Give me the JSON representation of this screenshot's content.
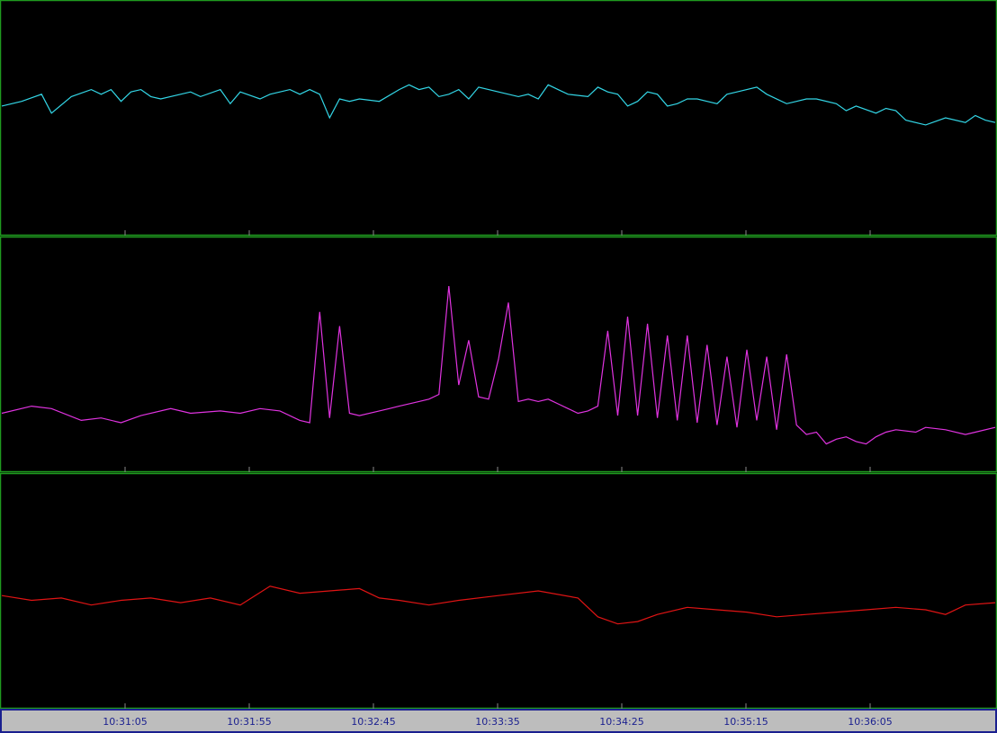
{
  "chart_data": {
    "type": "line",
    "x_unit": "time",
    "x_ticks": [
      "10:31:05",
      "10:31:55",
      "10:32:45",
      "10:33:35",
      "10:34:25",
      "10:35:15",
      "10:36:05"
    ],
    "x_range_seconds_per_tick": 50,
    "grid": false,
    "channels": [
      {
        "color": "#33d6e6",
        "ylim": [
          0,
          100
        ],
        "points": [
          [
            0,
            55
          ],
          [
            2,
            57
          ],
          [
            4,
            60
          ],
          [
            5,
            52
          ],
          [
            7,
            59
          ],
          [
            9,
            62
          ],
          [
            10,
            60
          ],
          [
            11,
            62
          ],
          [
            12,
            57
          ],
          [
            13,
            61
          ],
          [
            14,
            62
          ],
          [
            15,
            59
          ],
          [
            16,
            58
          ],
          [
            18,
            60
          ],
          [
            19,
            61
          ],
          [
            20,
            59
          ],
          [
            22,
            62
          ],
          [
            23,
            56
          ],
          [
            24,
            61
          ],
          [
            26,
            58
          ],
          [
            27,
            60
          ],
          [
            29,
            62
          ],
          [
            30,
            60
          ],
          [
            31,
            62
          ],
          [
            32,
            60
          ],
          [
            33,
            50
          ],
          [
            34,
            58
          ],
          [
            35,
            57
          ],
          [
            36,
            58
          ],
          [
            38,
            57
          ],
          [
            40,
            62
          ],
          [
            41,
            64
          ],
          [
            42,
            62
          ],
          [
            43,
            63
          ],
          [
            44,
            59
          ],
          [
            45,
            60
          ],
          [
            46,
            62
          ],
          [
            47,
            58
          ],
          [
            48,
            63
          ],
          [
            50,
            61
          ],
          [
            52,
            59
          ],
          [
            53,
            60
          ],
          [
            54,
            58
          ],
          [
            55,
            64
          ],
          [
            56,
            62
          ],
          [
            57,
            60
          ],
          [
            59,
            59
          ],
          [
            60,
            63
          ],
          [
            61,
            61
          ],
          [
            62,
            60
          ],
          [
            63,
            55
          ],
          [
            64,
            57
          ],
          [
            65,
            61
          ],
          [
            66,
            60
          ],
          [
            67,
            55
          ],
          [
            68,
            56
          ],
          [
            69,
            58
          ],
          [
            70,
            58
          ],
          [
            71,
            57
          ],
          [
            72,
            56
          ],
          [
            73,
            60
          ],
          [
            74,
            61
          ],
          [
            76,
            63
          ],
          [
            77,
            60
          ],
          [
            79,
            56
          ],
          [
            80,
            57
          ],
          [
            81,
            58
          ],
          [
            82,
            58
          ],
          [
            84,
            56
          ],
          [
            85,
            53
          ],
          [
            86,
            55
          ],
          [
            88,
            52
          ],
          [
            89,
            54
          ],
          [
            90,
            53
          ],
          [
            91,
            49
          ],
          [
            93,
            47
          ],
          [
            95,
            50
          ],
          [
            97,
            48
          ],
          [
            98,
            51
          ],
          [
            99,
            49
          ],
          [
            100,
            48
          ]
        ]
      },
      {
        "color": "#e033e0",
        "ylim": [
          0,
          100
        ],
        "points": [
          [
            0,
            25
          ],
          [
            3,
            28
          ],
          [
            5,
            27
          ],
          [
            8,
            22
          ],
          [
            10,
            23
          ],
          [
            12,
            21
          ],
          [
            14,
            24
          ],
          [
            17,
            27
          ],
          [
            19,
            25
          ],
          [
            22,
            26
          ],
          [
            24,
            25
          ],
          [
            26,
            27
          ],
          [
            28,
            26
          ],
          [
            30,
            22
          ],
          [
            31,
            21
          ],
          [
            32,
            68
          ],
          [
            33,
            23
          ],
          [
            34,
            62
          ],
          [
            35,
            25
          ],
          [
            36,
            24
          ],
          [
            38,
            26
          ],
          [
            39,
            27
          ],
          [
            40,
            28
          ],
          [
            42,
            30
          ],
          [
            43,
            31
          ],
          [
            44,
            33
          ],
          [
            45,
            79
          ],
          [
            46,
            37
          ],
          [
            47,
            56
          ],
          [
            48,
            32
          ],
          [
            49,
            31
          ],
          [
            50,
            48
          ],
          [
            51,
            72
          ],
          [
            52,
            30
          ],
          [
            53,
            31
          ],
          [
            54,
            30
          ],
          [
            55,
            31
          ],
          [
            56,
            29
          ],
          [
            57,
            27
          ],
          [
            58,
            25
          ],
          [
            59,
            26
          ],
          [
            60,
            28
          ],
          [
            61,
            60
          ],
          [
            62,
            24
          ],
          [
            63,
            66
          ],
          [
            64,
            24
          ],
          [
            65,
            63
          ],
          [
            66,
            23
          ],
          [
            67,
            58
          ],
          [
            68,
            22
          ],
          [
            69,
            58
          ],
          [
            70,
            21
          ],
          [
            71,
            54
          ],
          [
            72,
            20
          ],
          [
            73,
            49
          ],
          [
            74,
            19
          ],
          [
            75,
            52
          ],
          [
            76,
            22
          ],
          [
            77,
            49
          ],
          [
            78,
            18
          ],
          [
            79,
            50
          ],
          [
            80,
            20
          ],
          [
            81,
            16
          ],
          [
            82,
            17
          ],
          [
            83,
            12
          ],
          [
            84,
            14
          ],
          [
            85,
            15
          ],
          [
            86,
            13
          ],
          [
            87,
            12
          ],
          [
            88,
            15
          ],
          [
            89,
            17
          ],
          [
            90,
            18
          ],
          [
            92,
            17
          ],
          [
            93,
            19
          ],
          [
            95,
            18
          ],
          [
            97,
            16
          ],
          [
            98,
            17
          ],
          [
            100,
            19
          ]
        ]
      },
      {
        "color": "#e01414",
        "ylim": [
          0,
          100
        ],
        "points": [
          [
            0,
            48
          ],
          [
            3,
            46
          ],
          [
            6,
            47
          ],
          [
            9,
            44
          ],
          [
            12,
            46
          ],
          [
            15,
            47
          ],
          [
            18,
            45
          ],
          [
            21,
            47
          ],
          [
            24,
            44
          ],
          [
            27,
            52
          ],
          [
            30,
            49
          ],
          [
            33,
            50
          ],
          [
            36,
            51
          ],
          [
            38,
            47
          ],
          [
            40,
            46
          ],
          [
            43,
            44
          ],
          [
            46,
            46
          ],
          [
            50,
            48
          ],
          [
            54,
            50
          ],
          [
            58,
            47
          ],
          [
            60,
            39
          ],
          [
            62,
            36
          ],
          [
            64,
            37
          ],
          [
            66,
            40
          ],
          [
            69,
            43
          ],
          [
            72,
            42
          ],
          [
            75,
            41
          ],
          [
            78,
            39
          ],
          [
            81,
            40
          ],
          [
            84,
            41
          ],
          [
            87,
            42
          ],
          [
            90,
            43
          ],
          [
            93,
            42
          ],
          [
            95,
            40
          ],
          [
            97,
            44
          ],
          [
            100,
            45
          ]
        ]
      }
    ]
  },
  "time_axis": {
    "labels": [
      "10:31:05",
      "10:31:55",
      "10:32:45",
      "10:33:35",
      "10:34:25",
      "10:35:15",
      "10:36:05"
    ]
  }
}
